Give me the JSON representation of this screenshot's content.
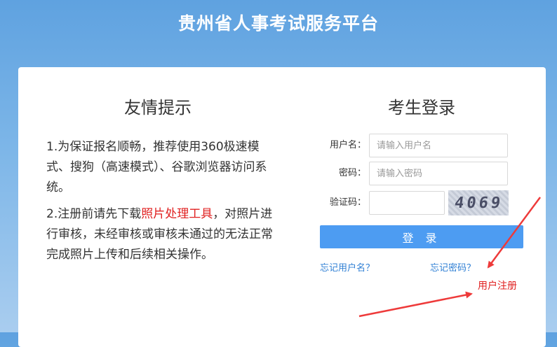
{
  "header": {
    "title": "贵州省人事考试服务平台"
  },
  "tips": {
    "title": "友情提示",
    "item1": "1.为保证报名顺畅，推荐使用360极速模式、搜狗（高速模式）、谷歌浏览器访问系统。",
    "item2_prefix": "2.注册前请先下载",
    "item2_link": "照片处理工具",
    "item2_suffix": "，对照片进行审核，未经审核或审核未通过的无法正常完成照片上传和后续相关操作。"
  },
  "login": {
    "title": "考生登录",
    "username_label": "用户名：",
    "username_placeholder": "请输入用户名",
    "password_label": "密码：",
    "password_placeholder": "请输入密码",
    "captcha_label": "验证码：",
    "captcha_text": "4069",
    "submit_label": "登 录",
    "forgot_username": "忘记用户名？",
    "forgot_password": "忘记密码？",
    "register": "用户注册"
  },
  "colors": {
    "accent": "#4d9cf2",
    "link": "#2f7fd4",
    "highlight": "#e02020"
  }
}
